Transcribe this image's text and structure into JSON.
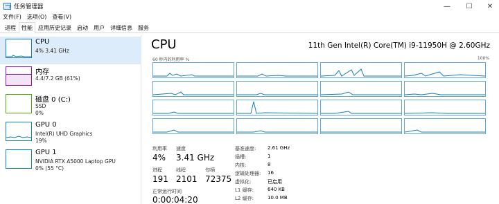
{
  "window": {
    "title": "任务管理器",
    "minimize": "—",
    "maximize": "☐",
    "close": "✕"
  },
  "menu": [
    "文件(F)",
    "选项(O)",
    "查看(V)"
  ],
  "tabs": [
    "进程",
    "性能",
    "应用历史记录",
    "启动",
    "用户",
    "详细信息",
    "服务"
  ],
  "active_tab": 1,
  "sidebar": [
    {
      "name": "CPU",
      "line2": "4% 3.41 GHz",
      "line3": "",
      "color": "#117dbb"
    },
    {
      "name": "内存",
      "line2": "4.4/7.2 GB (61%)",
      "line3": "",
      "color": "#8b12ae"
    },
    {
      "name": "磁盘 0 (C:)",
      "line2": "SSD",
      "line3": "0%",
      "color": "#4da60c"
    },
    {
      "name": "GPU 0",
      "line2": "Intel(R) UHD Graphics",
      "line3": "19%",
      "color": "#117dbb"
    },
    {
      "name": "GPU 1",
      "line2": "NVIDIA RTX A5000 Laptop GPU",
      "line3": "0% (55 °C)",
      "color": "#117dbb"
    }
  ],
  "main": {
    "title": "CPU",
    "model": "11th Gen Intel(R) Core(TM) i9-11950H @ 2.60GHz",
    "graph_label": "60 秒内的利用率 %",
    "graph_max": "100%",
    "line_color": "#117dbb",
    "cell_border": "#5ea5d8"
  },
  "stats": {
    "util_label": "利用率",
    "util_value": "4%",
    "speed_label": "速度",
    "speed_value": "3.41 GHz",
    "proc_label": "进程",
    "proc_value": "191",
    "thread_label": "线程",
    "thread_value": "2101",
    "handle_label": "句柄",
    "handle_value": "72375",
    "uptime_label": "正常运行时间",
    "uptime_value": "0:00:04:20"
  },
  "specs": [
    {
      "key": "基准速度:",
      "value": "2.61 GHz"
    },
    {
      "key": "插槽:",
      "value": "1"
    },
    {
      "key": "内核:",
      "value": "8"
    },
    {
      "key": "逻辑处理器:",
      "value": "16"
    },
    {
      "key": "虚拟化:",
      "value": "已启用"
    },
    {
      "key": "L1 缓存:",
      "value": "640 KB"
    },
    {
      "key": "L2 缓存:",
      "value": "10.0 MB"
    }
  ]
}
